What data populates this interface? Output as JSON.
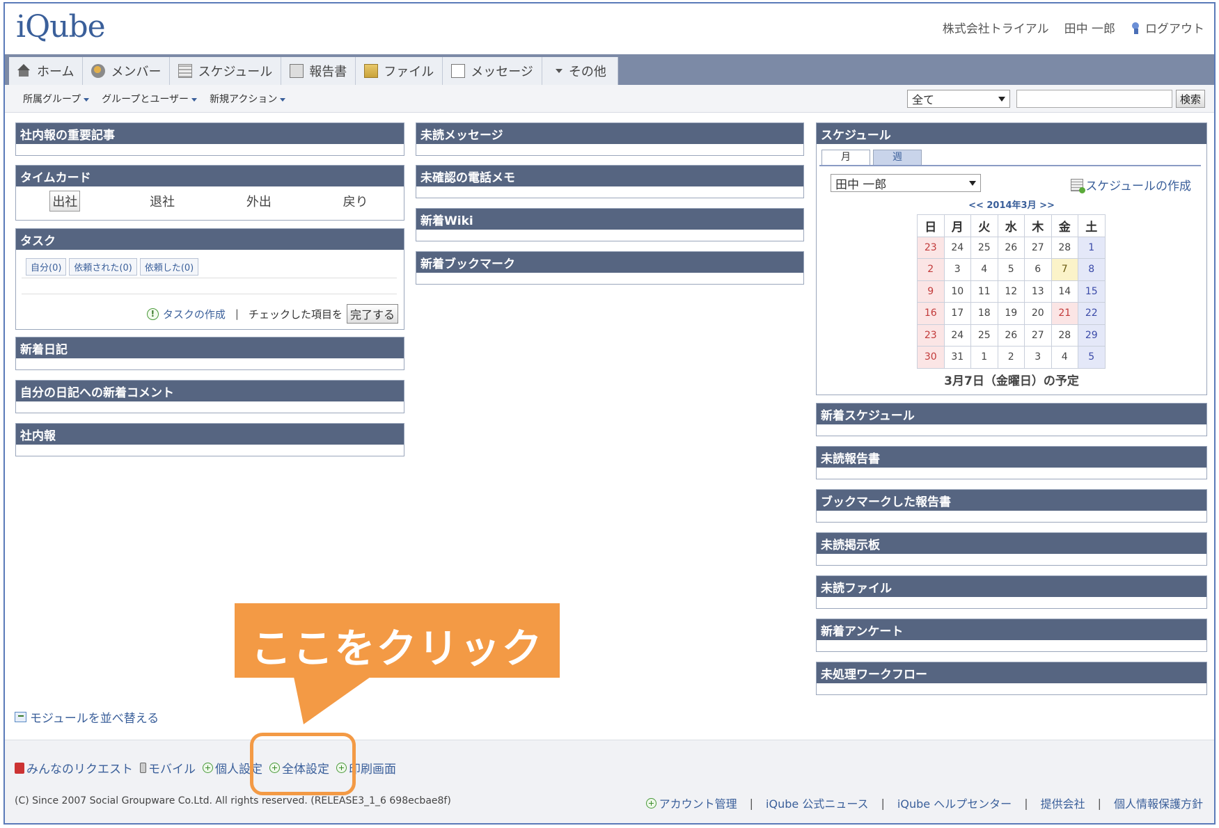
{
  "header": {
    "logo": "iQube",
    "company": "株式会社トライアル",
    "user": "田中 一郎",
    "logout": "ログアウト"
  },
  "nav": {
    "tabs": [
      {
        "label": "ホーム",
        "icon": "home-icon"
      },
      {
        "label": "メンバー",
        "icon": "member-icon"
      },
      {
        "label": "スケジュール",
        "icon": "schedule-icon"
      },
      {
        "label": "報告書",
        "icon": "report-icon"
      },
      {
        "label": "ファイル",
        "icon": "file-icon"
      },
      {
        "label": "メッセージ",
        "icon": "message-icon"
      },
      {
        "label": "その他",
        "icon": "dropdown-icon"
      }
    ]
  },
  "subnav": {
    "items": [
      "所属グループ",
      "グループとユーザー",
      "新規アクション"
    ],
    "search_scope": "全て",
    "search_value": "",
    "search_button": "検索"
  },
  "modules": {
    "important_news": "社内報の重要記事",
    "timecard": {
      "title": "タイムカード",
      "buttons": [
        "出社",
        "退社",
        "外出",
        "戻り"
      ]
    },
    "task": {
      "title": "タスク",
      "tabs": [
        "自分(0)",
        "依頼された(0)",
        "依頼した(0)"
      ],
      "create": "タスクの作成",
      "checked_label": "チェックした項目を",
      "complete_button": "完了する"
    },
    "new_diary": "新着日記",
    "diary_comments": "自分の日記への新着コメント",
    "company_news": "社内報",
    "unread_messages": "未読メッセージ",
    "phone_memos": "未確認の電話メモ",
    "new_wiki": "新着Wiki",
    "new_bookmarks": "新着ブックマーク",
    "new_schedule": "新着スケジュール",
    "unread_reports": "未読報告書",
    "bookmarked_reports": "ブックマークした報告書",
    "unread_board": "未読掲示板",
    "unread_files": "未読ファイル",
    "new_survey": "新着アンケート",
    "pending_workflow": "未処理ワークフロー"
  },
  "schedule": {
    "title": "スケジュール",
    "tabs": [
      "月",
      "週"
    ],
    "user": "田中 一郎",
    "create": "スケジュールの作成",
    "nav": "<< 2014年3月 >>",
    "weekdays": [
      "日",
      "月",
      "火",
      "水",
      "木",
      "金",
      "土"
    ],
    "weeks": [
      [
        "23",
        "24",
        "25",
        "26",
        "27",
        "28",
        "1"
      ],
      [
        "2",
        "3",
        "4",
        "5",
        "6",
        "7",
        "8"
      ],
      [
        "9",
        "10",
        "11",
        "12",
        "13",
        "14",
        "15"
      ],
      [
        "16",
        "17",
        "18",
        "19",
        "20",
        "21",
        "22"
      ],
      [
        "23",
        "24",
        "25",
        "26",
        "27",
        "28",
        "29"
      ],
      [
        "30",
        "31",
        "1",
        "2",
        "3",
        "4",
        "5"
      ]
    ],
    "selected_date": "3月7日（金曜日）の予定"
  },
  "footer": {
    "rearrange": "モジュールを並べ替える",
    "links": [
      "みんなのリクエスト",
      "モバイル",
      "個人設定",
      "全体設定",
      "印刷画面"
    ],
    "copyright": "(C) Since 2007 Social Groupware Co.Ltd. All rights reserved. (RELEASE3_1_6 698ecbae8f)",
    "bottom_links": [
      "アカウント管理",
      "iQube 公式ニュース",
      "iQube ヘルプセンター",
      "提供会社",
      "個人情報保護方針"
    ]
  },
  "callout": {
    "text": "ここをクリック",
    "color": "#f39a45"
  }
}
